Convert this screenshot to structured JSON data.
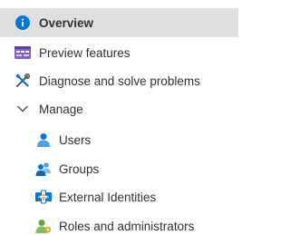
{
  "nav": {
    "overview": {
      "label": "Overview",
      "icon": "info-icon",
      "selected": true
    },
    "preview_features": {
      "label": "Preview features",
      "icon": "preview-features-icon"
    },
    "diagnose": {
      "label": "Diagnose and solve problems",
      "icon": "wrench-screwdriver-icon"
    },
    "manage": {
      "label": "Manage",
      "icon": "chevron-down-icon",
      "expanded": true,
      "items": [
        {
          "label": "Users",
          "icon": "user-icon"
        },
        {
          "label": "Groups",
          "icon": "groups-icon"
        },
        {
          "label": "External Identities",
          "icon": "external-identities-icon"
        },
        {
          "label": "Roles and administrators",
          "icon": "roles-admin-icon"
        }
      ]
    }
  },
  "colors": {
    "selected_bg": "#e1dfdd",
    "accent_blue": "#0078d4",
    "text": "#323130",
    "preview_purple": "#8661c5",
    "admin_green": "#5ea838"
  }
}
